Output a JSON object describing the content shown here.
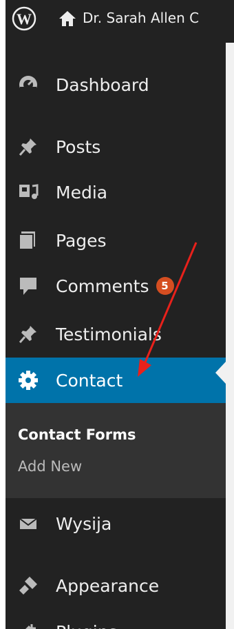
{
  "adminbar": {
    "logo_icon": "wordpress-logo-icon",
    "home_icon": "home-icon",
    "site_name": "Dr. Sarah Allen C"
  },
  "sidebar": {
    "items": [
      {
        "label": "Dashboard",
        "icon": "dashboard-icon"
      },
      {
        "label": "Posts",
        "icon": "pushpin-icon"
      },
      {
        "label": "Media",
        "icon": "media-icon"
      },
      {
        "label": "Pages",
        "icon": "pages-icon"
      },
      {
        "label": "Comments",
        "icon": "comment-icon",
        "badge": "5"
      },
      {
        "label": "Testimonials",
        "icon": "pushpin-icon"
      },
      {
        "label": "Contact",
        "icon": "gear-icon",
        "active": true
      },
      {
        "label": "Wysija",
        "icon": "envelope-icon"
      },
      {
        "label": "Appearance",
        "icon": "brush-icon"
      },
      {
        "label": "Plugins",
        "icon": "plug-icon"
      }
    ],
    "submenu": {
      "current": "Contact Forms",
      "add_new": "Add New"
    }
  },
  "colors": {
    "menu_bg": "#222222",
    "submenu_bg": "#333333",
    "active_bg": "#0073aa",
    "badge_bg": "#d54e21",
    "arrow": "#e8211b"
  }
}
